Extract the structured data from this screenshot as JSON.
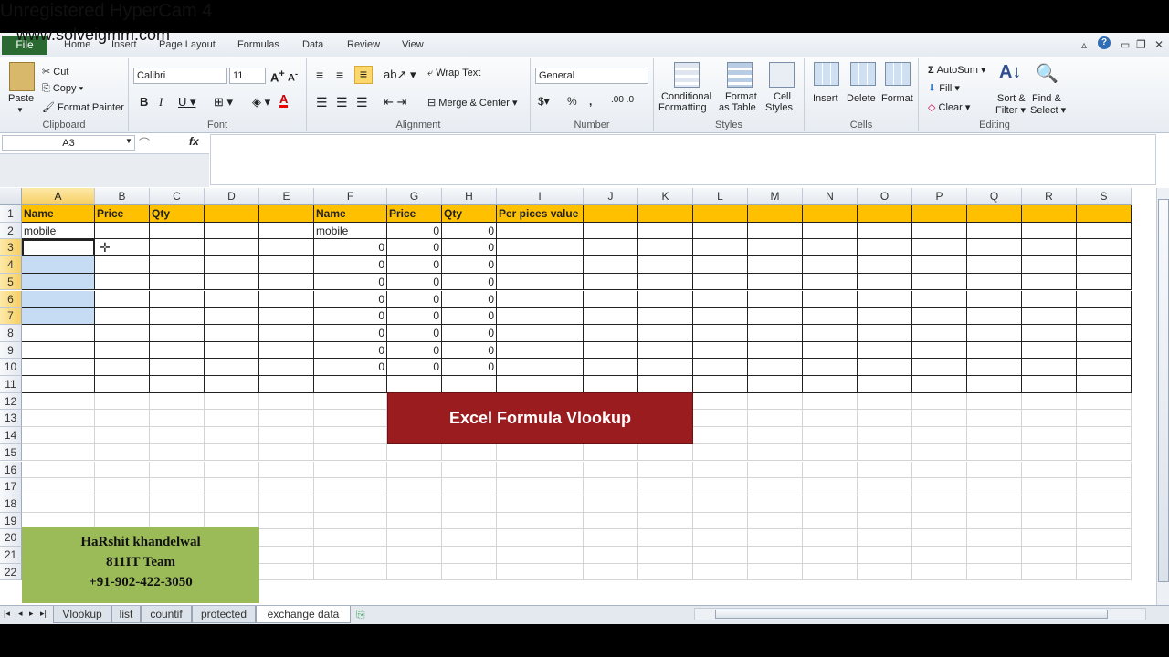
{
  "watermark": {
    "line1": "Unregistered HyperCam 4",
    "line2": "www.solveigmm.com"
  },
  "ribbon_tabs": [
    "File",
    "Home",
    "Insert",
    "Page Layout",
    "Formulas",
    "Data",
    "Review",
    "View"
  ],
  "ribbon": {
    "clipboard": {
      "label": "Clipboard",
      "paste": "Paste",
      "cut": "Cut",
      "copy": "Copy",
      "format_painter": "Format Painter"
    },
    "font": {
      "label": "Font",
      "name": "Calibri",
      "size": "11"
    },
    "alignment": {
      "label": "Alignment",
      "wrap_text": "Wrap Text",
      "merge_center": "Merge & Center"
    },
    "number": {
      "label": "Number",
      "format": "General"
    },
    "styles": {
      "label": "Styles",
      "conditional": "Conditional",
      "conditional2": "Formatting",
      "format_table": "Format",
      "format_table2": "as Table",
      "cell_styles": "Cell",
      "cell_styles2": "Styles"
    },
    "cells": {
      "label": "Cells",
      "insert": "Insert",
      "delete": "Delete",
      "format": "Format"
    },
    "editing": {
      "label": "Editing",
      "autosum": "AutoSum",
      "fill": "Fill",
      "clear": "Clear",
      "sort": "Sort &",
      "sort2": "Filter",
      "find": "Find &",
      "find2": "Select"
    }
  },
  "formula_bar": {
    "name_box": "A3",
    "fx": "fx",
    "value": ""
  },
  "columns": [
    "A",
    "B",
    "C",
    "D",
    "E",
    "F",
    "G",
    "H",
    "I",
    "J",
    "K",
    "L",
    "M",
    "N",
    "O",
    "P",
    "Q",
    "R",
    "S"
  ],
  "rows": [
    "1",
    "2",
    "3",
    "4",
    "5",
    "6",
    "7",
    "8",
    "9",
    "10",
    "11",
    "12",
    "13",
    "14",
    "15",
    "16",
    "17",
    "18",
    "19",
    "20",
    "21",
    "22"
  ],
  "table1": {
    "headers": [
      "Name",
      "Price",
      "Qty",
      "",
      ""
    ],
    "row2": "mobile"
  },
  "table2": {
    "headers": [
      "Name",
      "Price",
      "Qty",
      "Per pices value"
    ],
    "rows": [
      [
        "mobile",
        "0",
        "0"
      ],
      [
        "0",
        "0",
        "0"
      ],
      [
        "0",
        "0",
        "0"
      ],
      [
        "0",
        "0",
        "0"
      ],
      [
        "0",
        "0",
        "0"
      ],
      [
        "0",
        "0",
        "0"
      ],
      [
        "0",
        "0",
        "0"
      ],
      [
        "0",
        "0",
        "0"
      ],
      [
        "0",
        "0",
        "0"
      ]
    ]
  },
  "banner": "Excel Formula Vlookup",
  "credit": {
    "line1": "HaRshit khandelwal",
    "line2": "811IT Team",
    "line3": "+91-902-422-3050"
  },
  "sheet_tabs": [
    "Vlookup",
    "list",
    "countif",
    "protected",
    "exchange data"
  ],
  "active_sheet": "exchange data"
}
